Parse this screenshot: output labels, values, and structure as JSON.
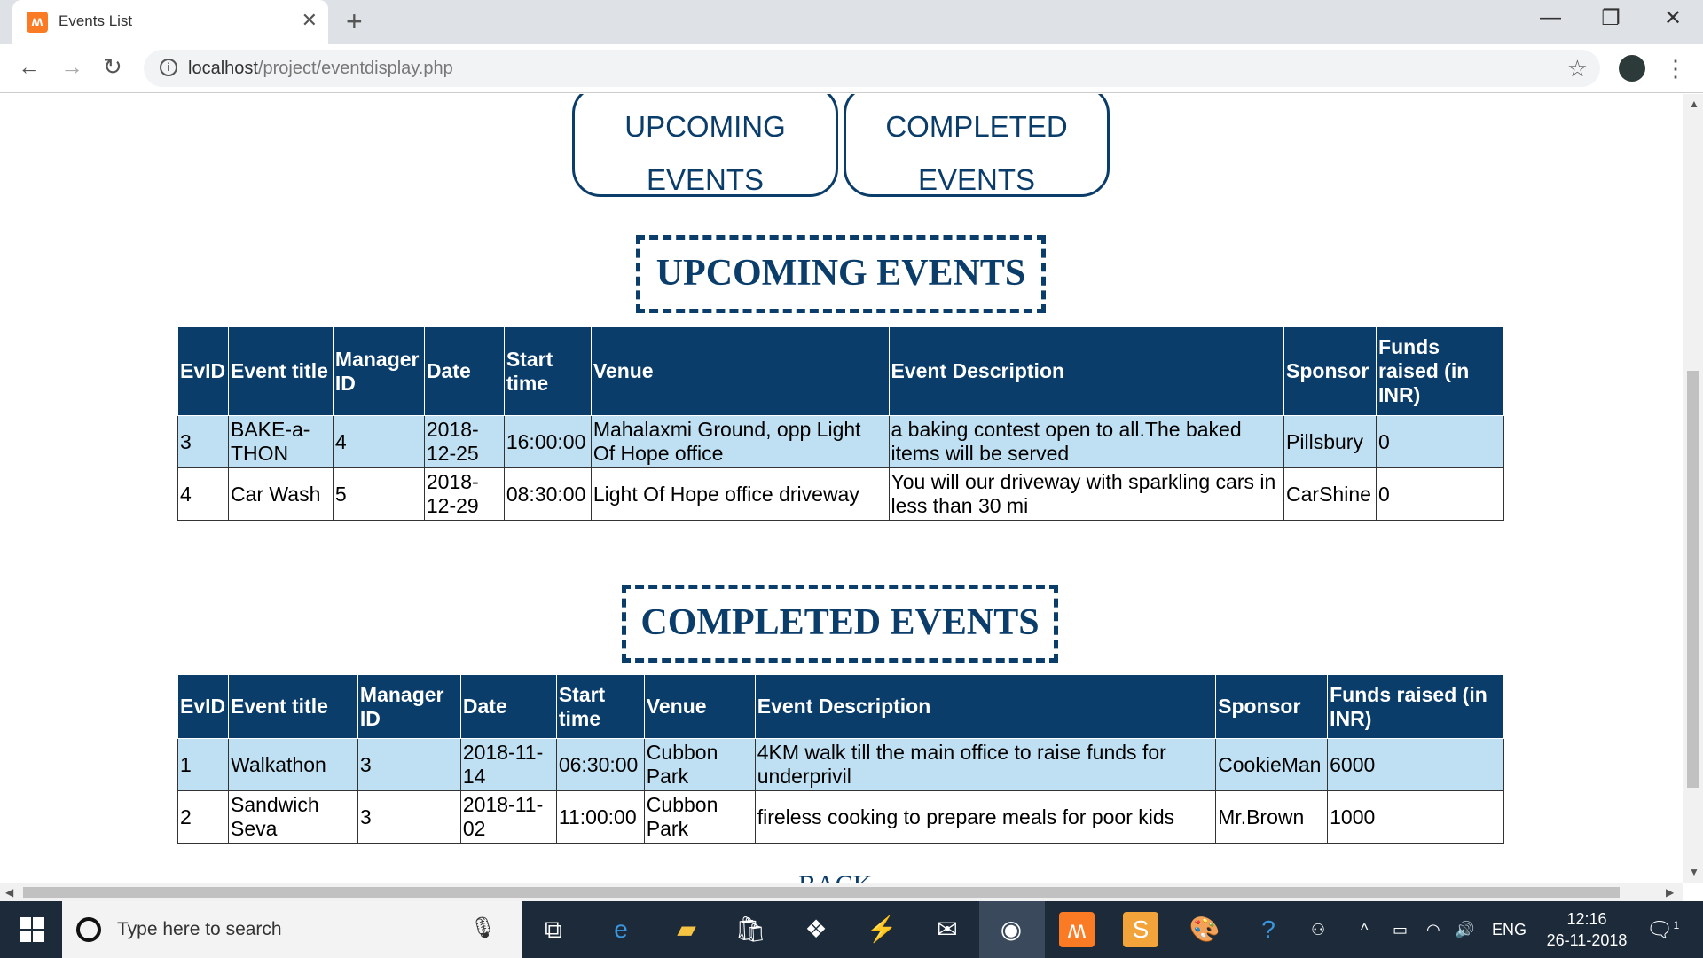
{
  "browser": {
    "tab_title": "Events List",
    "tab_close": "✕",
    "new_tab": "+",
    "url_host": "localhost",
    "url_path": "/project/eventdisplay.php",
    "win_min": "—",
    "win_restore": "❐",
    "win_close": "✕"
  },
  "nav": {
    "upcoming_line1": "UPCOMING",
    "upcoming_line2": "EVENTS",
    "completed_line1": "COMPLETED",
    "completed_line2": "EVENTS"
  },
  "upcoming": {
    "heading": "UPCOMING EVENTS",
    "headers": [
      "EvID",
      "Event title",
      "Manager ID",
      "Date",
      "Start time",
      "Venue",
      "Event Description",
      "Sponsor",
      "Funds raised (in INR)"
    ],
    "rows": [
      [
        "3",
        "BAKE-a-THON",
        "4",
        "2018-12-25",
        "16:00:00",
        "Mahalaxmi Ground, opp Light Of Hope office",
        "a baking contest open to all.The baked items will be served",
        "Pillsbury",
        "0"
      ],
      [
        "4",
        "Car Wash",
        "5",
        "2018-12-29",
        "08:30:00",
        "Light Of Hope office driveway",
        "You will our driveway with sparkling cars in less than 30 mi",
        "CarShine",
        "0"
      ]
    ]
  },
  "completed": {
    "heading": "COMPLETED EVENTS",
    "headers": [
      "EvID",
      "Event title",
      "Manager ID",
      "Date",
      "Start time",
      "Venue",
      "Event Description",
      "Sponsor",
      "Funds raised (in INR)"
    ],
    "rows": [
      [
        "1",
        "Walkathon",
        "3",
        "2018-11-14",
        "06:30:00",
        "Cubbon Park",
        "4KM walk till the main office to raise funds for underprivil",
        "CookieMan",
        "6000"
      ],
      [
        "2",
        "Sandwich Seva",
        "3",
        "2018-11-02",
        "11:00:00",
        "Cubbon Park",
        "fireless cooking to prepare meals for poor kids",
        "Mr.Brown",
        "1000"
      ]
    ]
  },
  "back_label": "BACK",
  "taskbar": {
    "search_placeholder": "Type here to search",
    "lang": "ENG",
    "time": "12:16",
    "date": "26-11-2018",
    "notif_count": "1"
  },
  "colors": {
    "primary": "#0b3d6b",
    "row_alt": "#bfe0f2"
  }
}
